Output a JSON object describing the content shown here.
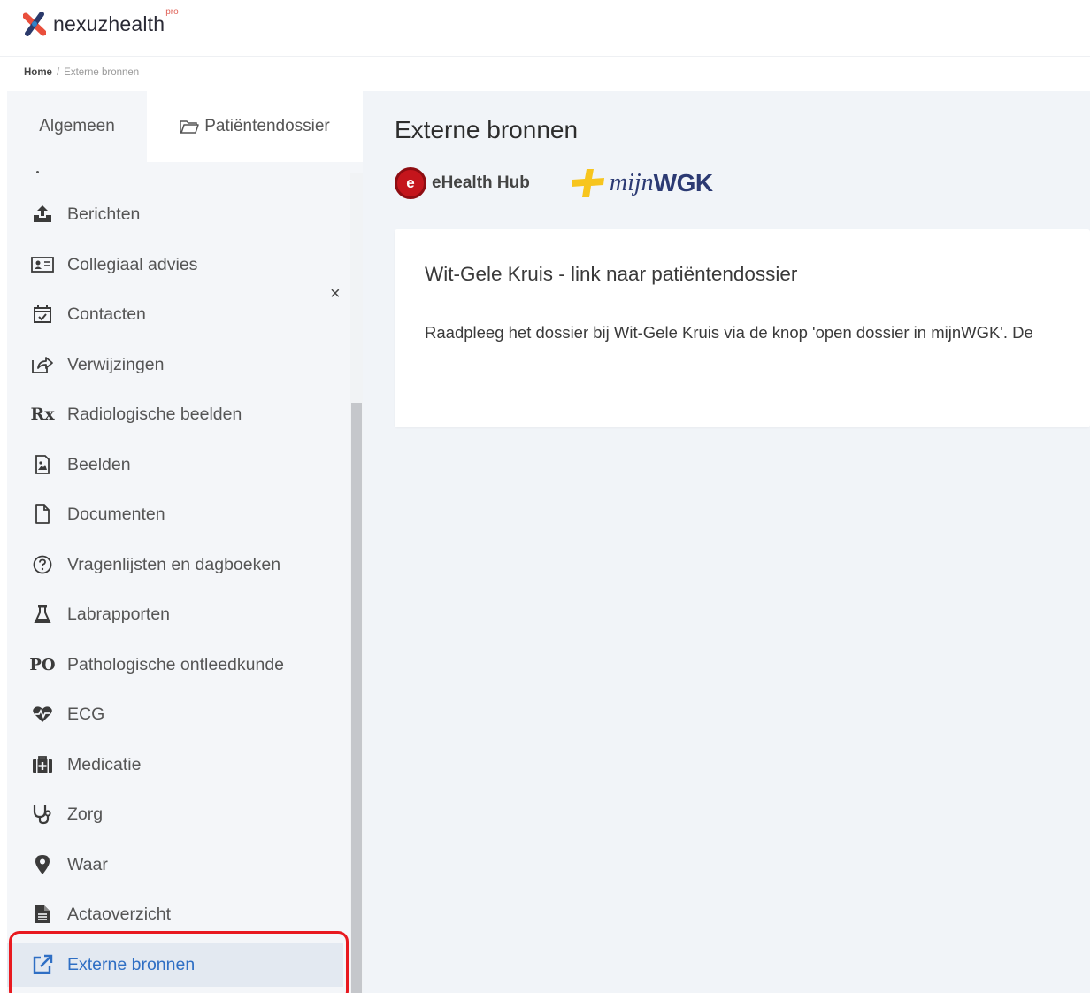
{
  "app": {
    "brand": "nexuzhealth",
    "brand_suffix": "pro"
  },
  "breadcrumb": {
    "home": "Home",
    "separator": "/",
    "current": "Externe bronnen"
  },
  "sidebar": {
    "tabs": [
      {
        "label": "Algemeen"
      },
      {
        "label": "Patiëntendossier",
        "icon": "folder-icon"
      }
    ],
    "items": [
      {
        "label": "Berichten",
        "icon": "upload-icon"
      },
      {
        "label": "Collegiaal advies",
        "icon": "id-card-icon"
      },
      {
        "label": "Contacten",
        "icon": "calendar-check-icon"
      },
      {
        "label": "Verwijzingen",
        "icon": "share-icon"
      },
      {
        "label": "Radiologische beelden",
        "icon": "rx-icon",
        "glyph": "Rx"
      },
      {
        "label": "Beelden",
        "icon": "image-file-icon"
      },
      {
        "label": "Documenten",
        "icon": "document-icon"
      },
      {
        "label": "Vragenlijsten en dagboeken",
        "icon": "question-circle-icon"
      },
      {
        "label": "Labrapporten",
        "icon": "flask-icon"
      },
      {
        "label": "Pathologische ontleedkunde",
        "icon": "po-icon",
        "glyph": "PO"
      },
      {
        "label": "ECG",
        "icon": "heartbeat-icon"
      },
      {
        "label": "Medicatie",
        "icon": "medkit-icon"
      },
      {
        "label": "Zorg",
        "icon": "stethoscope-icon"
      },
      {
        "label": "Waar",
        "icon": "map-pin-icon"
      },
      {
        "label": "Actaoverzicht",
        "icon": "file-text-icon"
      },
      {
        "label": "Externe bronnen",
        "icon": "external-link-icon",
        "active": true
      }
    ],
    "close_glyph": "×"
  },
  "main": {
    "title": "Externe bronnen",
    "sources": [
      {
        "label": "eHealth Hub",
        "badge": "e"
      },
      {
        "label_italic": "mijn",
        "label_bold": "WGK"
      }
    ],
    "card": {
      "title": "Wit-Gele Kruis - link naar patiëntendossier",
      "body": "Raadpleeg het dossier bij Wit-Gele Kruis via de knop 'open dossier in mijnWGK'. De"
    }
  },
  "colors": {
    "active_accent": "#2f6fc4",
    "highlight_border": "#e8191f",
    "ehealth_red": "#c4151c",
    "wgk_navy": "#2c3a73",
    "wgk_yellow": "#f7c51e"
  }
}
